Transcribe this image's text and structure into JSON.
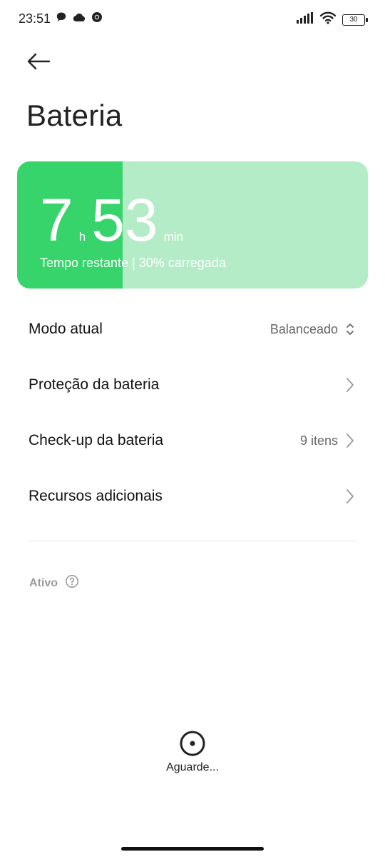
{
  "status_bar": {
    "time": "23:51",
    "battery_level": "30",
    "icons": [
      "chat-icon",
      "cloud-icon",
      "chrome-icon",
      "signal-icon",
      "wifi-icon",
      "battery-icon"
    ]
  },
  "header": {
    "title": "Bateria"
  },
  "battery_card": {
    "hours": "7",
    "hours_unit": "h",
    "minutes": "53",
    "minutes_unit": "min",
    "subtitle": "Tempo restante | 30% carregada",
    "charge_fraction": 0.3,
    "colors": {
      "fill": "#36d46a",
      "background": "#b3ecc6"
    }
  },
  "list": [
    {
      "label": "Modo atual",
      "value": "Balanceado",
      "icon": "updown-chevron-icon"
    },
    {
      "label": "Proteção da bateria",
      "value": "",
      "icon": "chevron-right-icon"
    },
    {
      "label": "Check-up da bateria",
      "value": "9 itens",
      "icon": "chevron-right-icon"
    },
    {
      "label": "Recursos adicionais",
      "value": "",
      "icon": "chevron-right-icon"
    }
  ],
  "section": {
    "label": "Ativo",
    "icon": "help-circle-icon"
  },
  "loading": {
    "text": "Aguarde..."
  }
}
